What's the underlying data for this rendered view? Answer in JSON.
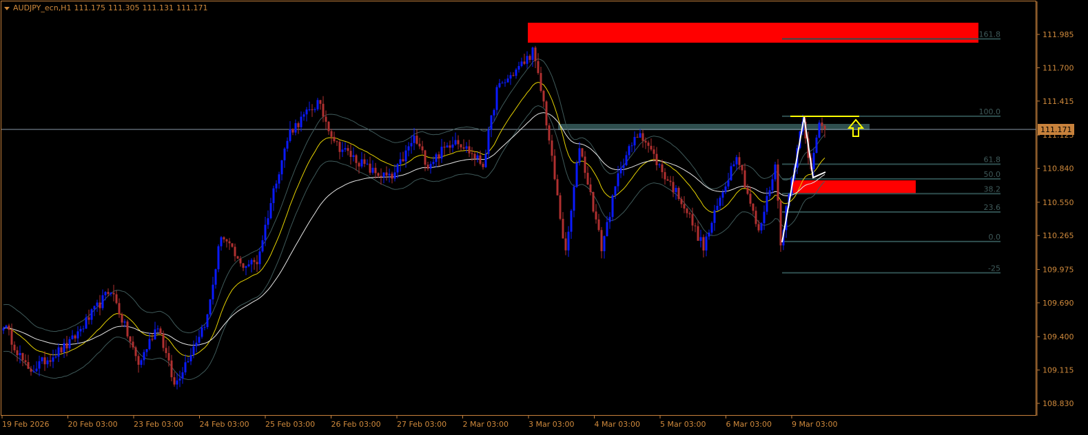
{
  "header": {
    "symbol": "AUDJPY_ecn,H1",
    "open": "111.175",
    "high": "111.305",
    "low": "111.131",
    "close": "111.171"
  },
  "price_axis": [
    "111.985",
    "111.700",
    "111.415",
    "111.125",
    "110.840",
    "110.550",
    "110.265",
    "109.975",
    "109.690",
    "109.400",
    "109.115",
    "108.830"
  ],
  "current_price": "111.171",
  "time_axis": [
    "19 Feb 2026",
    "20 Feb 03:00",
    "23 Feb 03:00",
    "24 Feb 03:00",
    "25 Feb 03:00",
    "26 Feb 03:00",
    "27 Feb 03:00",
    "2 Mar 03:00",
    "3 Mar 03:00",
    "4 Mar 03:00",
    "5 Mar 03:00",
    "6 Mar 03:00",
    "9 Mar 03:00"
  ],
  "fibonacci": {
    "price_0": 110.214,
    "price_100": 111.285,
    "levels": [
      "161.8",
      "100.0",
      "61.8",
      "50.0",
      "38.2",
      "23.6",
      "0.0",
      "-25"
    ]
  },
  "colors": {
    "bull": "#0a1aff",
    "bear": "#b03030",
    "frame": "#c8823c",
    "zone": "#ff0000",
    "fib": "#2f4f4f",
    "ma_fast": "#e6d200",
    "ma_slow": "#e8e8e8"
  },
  "price_path": [
    [
      0,
      109.51
    ],
    [
      9,
      109.1
    ],
    [
      24,
      109.34
    ],
    [
      39,
      109.81
    ],
    [
      49,
      109.16
    ],
    [
      56,
      109.51
    ],
    [
      62,
      108.98
    ],
    [
      74,
      109.57
    ],
    [
      79,
      110.28
    ],
    [
      86,
      110.01
    ],
    [
      92,
      110.04
    ],
    [
      99,
      110.75
    ],
    [
      104,
      111.16
    ],
    [
      114,
      111.4
    ],
    [
      121,
      111.04
    ],
    [
      134,
      110.81
    ],
    [
      141,
      110.75
    ],
    [
      149,
      111.1
    ],
    [
      154,
      110.87
    ],
    [
      164,
      111.1
    ],
    [
      174,
      110.87
    ],
    [
      179,
      111.51
    ],
    [
      189,
      111.75
    ],
    [
      192,
      111.84
    ],
    [
      196,
      111.4
    ],
    [
      200,
      110.75
    ],
    [
      204,
      110.1
    ],
    [
      209,
      111.04
    ],
    [
      214,
      110.51
    ],
    [
      217,
      110.16
    ],
    [
      224,
      110.87
    ],
    [
      231,
      111.16
    ],
    [
      239,
      110.81
    ],
    [
      246,
      110.57
    ],
    [
      254,
      110.16
    ],
    [
      259,
      110.51
    ],
    [
      266,
      110.98
    ],
    [
      274,
      110.28
    ],
    [
      280,
      110.87
    ],
    [
      282,
      110.22
    ],
    [
      290,
      111.28
    ],
    [
      293,
      110.81
    ],
    [
      296,
      111.22
    ],
    [
      298,
      111.171
    ]
  ]
}
